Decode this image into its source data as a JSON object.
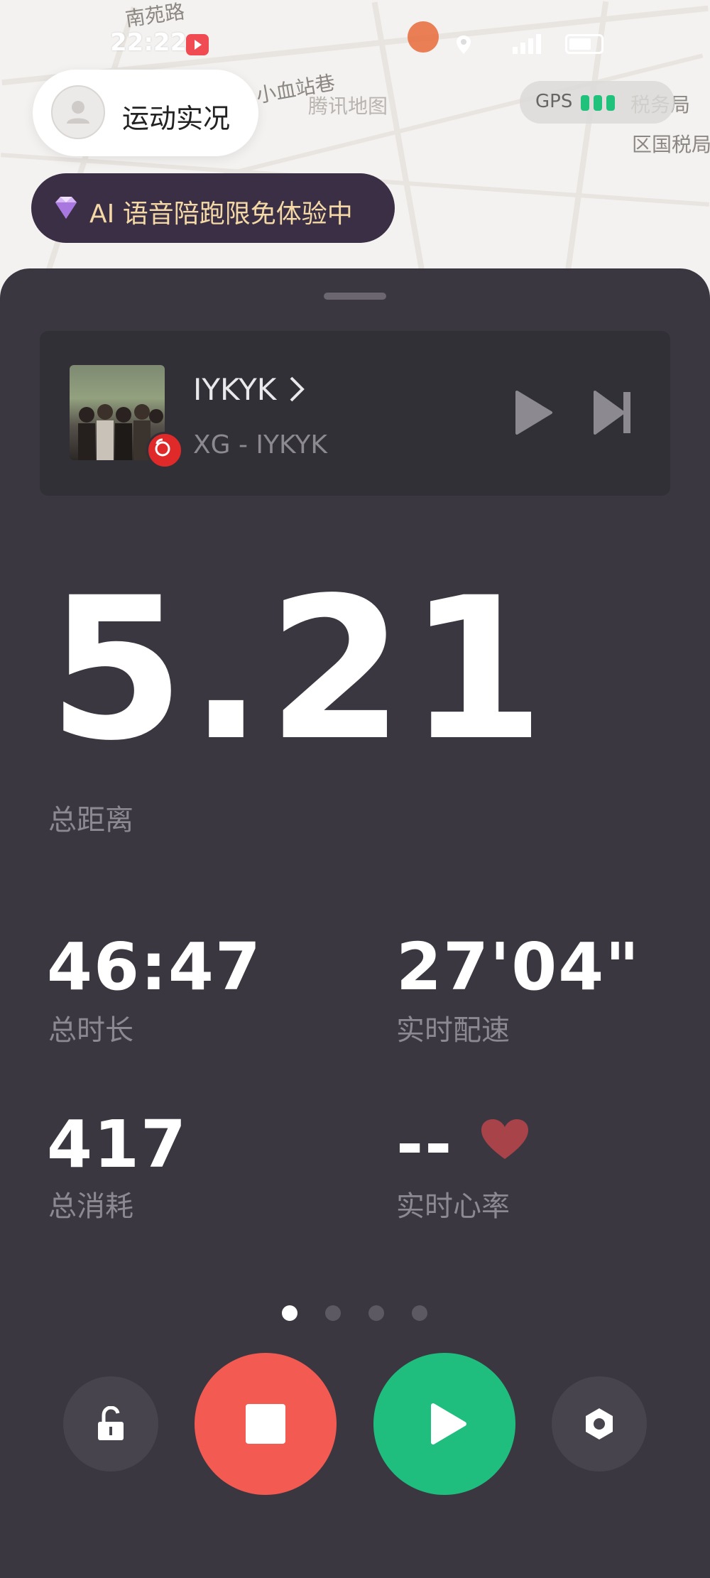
{
  "status_bar": {
    "time": "22:22"
  },
  "map": {
    "labels": [
      "南苑路",
      "小血站巷",
      "腾讯地图",
      "税务局",
      "区国税局"
    ]
  },
  "top_overlay": {
    "activity_label": "运动实况",
    "gps_label": "GPS",
    "gps_signal_bars": 3,
    "ai_banner": "AI 语音陪跑限免体验中"
  },
  "music": {
    "title": "IYKYK",
    "artist_line": "XG - IYKYK",
    "source_icon": "netease-music-icon"
  },
  "stats": {
    "distance": {
      "value": "5.21",
      "label": "总距离"
    },
    "duration": {
      "value": "46:47",
      "label": "总时长"
    },
    "pace": {
      "value": "27'04\"",
      "label": "实时配速"
    },
    "calories": {
      "value": "417",
      "label": "总消耗"
    },
    "heart_rate": {
      "value": "--",
      "label": "实时心率"
    }
  },
  "pager": {
    "pages": 4,
    "current": 1
  },
  "controls": {
    "lock": "unlock-icon",
    "stop": "stop-icon",
    "resume": "play-icon",
    "settings": "settings-icon"
  },
  "colors": {
    "panel_bg": "#3b3740",
    "stop_button": "#f25a52",
    "resume_button": "#1fbe7e",
    "heart": "#a8434a",
    "ai_text": "#f4d9a6"
  }
}
